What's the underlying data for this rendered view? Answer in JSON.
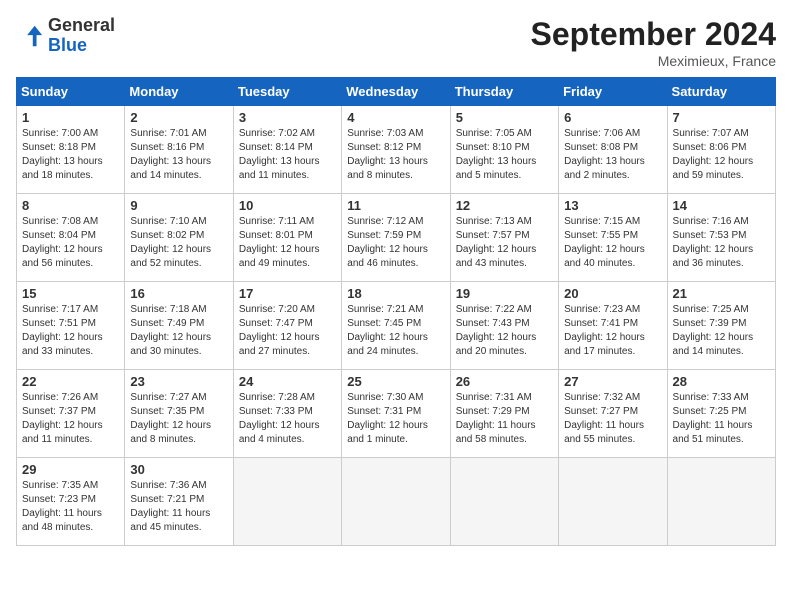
{
  "header": {
    "logo_general": "General",
    "logo_blue": "Blue",
    "month_title": "September 2024",
    "location": "Meximieux, France"
  },
  "weekdays": [
    "Sunday",
    "Monday",
    "Tuesday",
    "Wednesday",
    "Thursday",
    "Friday",
    "Saturday"
  ],
  "days": [
    {
      "num": "",
      "info": ""
    },
    {
      "num": "",
      "info": ""
    },
    {
      "num": "",
      "info": ""
    },
    {
      "num": "",
      "info": ""
    },
    {
      "num": "",
      "info": ""
    },
    {
      "num": "",
      "info": ""
    },
    {
      "num": "1",
      "sunrise": "Sunrise: 7:00 AM",
      "sunset": "Sunset: 8:18 PM",
      "daylight": "Daylight: 13 hours and 18 minutes."
    },
    {
      "num": "2",
      "sunrise": "Sunrise: 7:01 AM",
      "sunset": "Sunset: 8:16 PM",
      "daylight": "Daylight: 13 hours and 14 minutes."
    },
    {
      "num": "3",
      "sunrise": "Sunrise: 7:02 AM",
      "sunset": "Sunset: 8:14 PM",
      "daylight": "Daylight: 13 hours and 11 minutes."
    },
    {
      "num": "4",
      "sunrise": "Sunrise: 7:03 AM",
      "sunset": "Sunset: 8:12 PM",
      "daylight": "Daylight: 13 hours and 8 minutes."
    },
    {
      "num": "5",
      "sunrise": "Sunrise: 7:05 AM",
      "sunset": "Sunset: 8:10 PM",
      "daylight": "Daylight: 13 hours and 5 minutes."
    },
    {
      "num": "6",
      "sunrise": "Sunrise: 7:06 AM",
      "sunset": "Sunset: 8:08 PM",
      "daylight": "Daylight: 13 hours and 2 minutes."
    },
    {
      "num": "7",
      "sunrise": "Sunrise: 7:07 AM",
      "sunset": "Sunset: 8:06 PM",
      "daylight": "Daylight: 12 hours and 59 minutes."
    },
    {
      "num": "8",
      "sunrise": "Sunrise: 7:08 AM",
      "sunset": "Sunset: 8:04 PM",
      "daylight": "Daylight: 12 hours and 56 minutes."
    },
    {
      "num": "9",
      "sunrise": "Sunrise: 7:10 AM",
      "sunset": "Sunset: 8:02 PM",
      "daylight": "Daylight: 12 hours and 52 minutes."
    },
    {
      "num": "10",
      "sunrise": "Sunrise: 7:11 AM",
      "sunset": "Sunset: 8:01 PM",
      "daylight": "Daylight: 12 hours and 49 minutes."
    },
    {
      "num": "11",
      "sunrise": "Sunrise: 7:12 AM",
      "sunset": "Sunset: 7:59 PM",
      "daylight": "Daylight: 12 hours and 46 minutes."
    },
    {
      "num": "12",
      "sunrise": "Sunrise: 7:13 AM",
      "sunset": "Sunset: 7:57 PM",
      "daylight": "Daylight: 12 hours and 43 minutes."
    },
    {
      "num": "13",
      "sunrise": "Sunrise: 7:15 AM",
      "sunset": "Sunset: 7:55 PM",
      "daylight": "Daylight: 12 hours and 40 minutes."
    },
    {
      "num": "14",
      "sunrise": "Sunrise: 7:16 AM",
      "sunset": "Sunset: 7:53 PM",
      "daylight": "Daylight: 12 hours and 36 minutes."
    },
    {
      "num": "15",
      "sunrise": "Sunrise: 7:17 AM",
      "sunset": "Sunset: 7:51 PM",
      "daylight": "Daylight: 12 hours and 33 minutes."
    },
    {
      "num": "16",
      "sunrise": "Sunrise: 7:18 AM",
      "sunset": "Sunset: 7:49 PM",
      "daylight": "Daylight: 12 hours and 30 minutes."
    },
    {
      "num": "17",
      "sunrise": "Sunrise: 7:20 AM",
      "sunset": "Sunset: 7:47 PM",
      "daylight": "Daylight: 12 hours and 27 minutes."
    },
    {
      "num": "18",
      "sunrise": "Sunrise: 7:21 AM",
      "sunset": "Sunset: 7:45 PM",
      "daylight": "Daylight: 12 hours and 24 minutes."
    },
    {
      "num": "19",
      "sunrise": "Sunrise: 7:22 AM",
      "sunset": "Sunset: 7:43 PM",
      "daylight": "Daylight: 12 hours and 20 minutes."
    },
    {
      "num": "20",
      "sunrise": "Sunrise: 7:23 AM",
      "sunset": "Sunset: 7:41 PM",
      "daylight": "Daylight: 12 hours and 17 minutes."
    },
    {
      "num": "21",
      "sunrise": "Sunrise: 7:25 AM",
      "sunset": "Sunset: 7:39 PM",
      "daylight": "Daylight: 12 hours and 14 minutes."
    },
    {
      "num": "22",
      "sunrise": "Sunrise: 7:26 AM",
      "sunset": "Sunset: 7:37 PM",
      "daylight": "Daylight: 12 hours and 11 minutes."
    },
    {
      "num": "23",
      "sunrise": "Sunrise: 7:27 AM",
      "sunset": "Sunset: 7:35 PM",
      "daylight": "Daylight: 12 hours and 8 minutes."
    },
    {
      "num": "24",
      "sunrise": "Sunrise: 7:28 AM",
      "sunset": "Sunset: 7:33 PM",
      "daylight": "Daylight: 12 hours and 4 minutes."
    },
    {
      "num": "25",
      "sunrise": "Sunrise: 7:30 AM",
      "sunset": "Sunset: 7:31 PM",
      "daylight": "Daylight: 12 hours and 1 minute."
    },
    {
      "num": "26",
      "sunrise": "Sunrise: 7:31 AM",
      "sunset": "Sunset: 7:29 PM",
      "daylight": "Daylight: 11 hours and 58 minutes."
    },
    {
      "num": "27",
      "sunrise": "Sunrise: 7:32 AM",
      "sunset": "Sunset: 7:27 PM",
      "daylight": "Daylight: 11 hours and 55 minutes."
    },
    {
      "num": "28",
      "sunrise": "Sunrise: 7:33 AM",
      "sunset": "Sunset: 7:25 PM",
      "daylight": "Daylight: 11 hours and 51 minutes."
    },
    {
      "num": "29",
      "sunrise": "Sunrise: 7:35 AM",
      "sunset": "Sunset: 7:23 PM",
      "daylight": "Daylight: 11 hours and 48 minutes."
    },
    {
      "num": "30",
      "sunrise": "Sunrise: 7:36 AM",
      "sunset": "Sunset: 7:21 PM",
      "daylight": "Daylight: 11 hours and 45 minutes."
    }
  ]
}
